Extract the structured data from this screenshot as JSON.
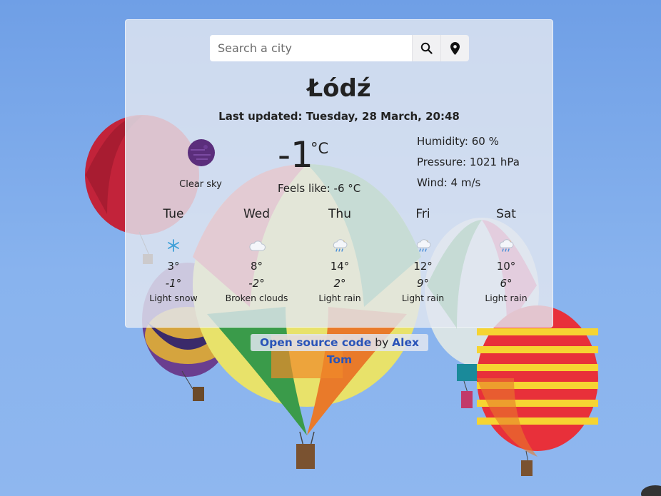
{
  "search": {
    "placeholder": "Search a city"
  },
  "city": "Łódź",
  "last_updated": "Last updated: Tuesday, 28 March, 20:48",
  "current": {
    "condition": "Clear sky",
    "temperature": "-1",
    "unit": "°C",
    "feels_like": "Feels like: -6 °C",
    "humidity": "Humidity: 60 %",
    "pressure": "Pressure: 1021 hPa",
    "wind": "Wind: 4 m/s"
  },
  "forecast": [
    {
      "day": "Tue",
      "high": "3°",
      "low": "-1°",
      "desc": "Light snow",
      "icon": "snow-icon"
    },
    {
      "day": "Wed",
      "high": "8°",
      "low": "-2°",
      "desc": "Broken clouds",
      "icon": "cloud-icon"
    },
    {
      "day": "Thu",
      "high": "14°",
      "low": "2°",
      "desc": "Light rain",
      "icon": "rain-icon"
    },
    {
      "day": "Fri",
      "high": "12°",
      "low": "9°",
      "desc": "Light rain",
      "icon": "rain-icon"
    },
    {
      "day": "Sat",
      "high": "10°",
      "low": "6°",
      "desc": "Light rain",
      "icon": "rain-icon"
    }
  ],
  "footer": {
    "link_text": "Open source code",
    "by": " by ",
    "author": "Alex Tom"
  }
}
